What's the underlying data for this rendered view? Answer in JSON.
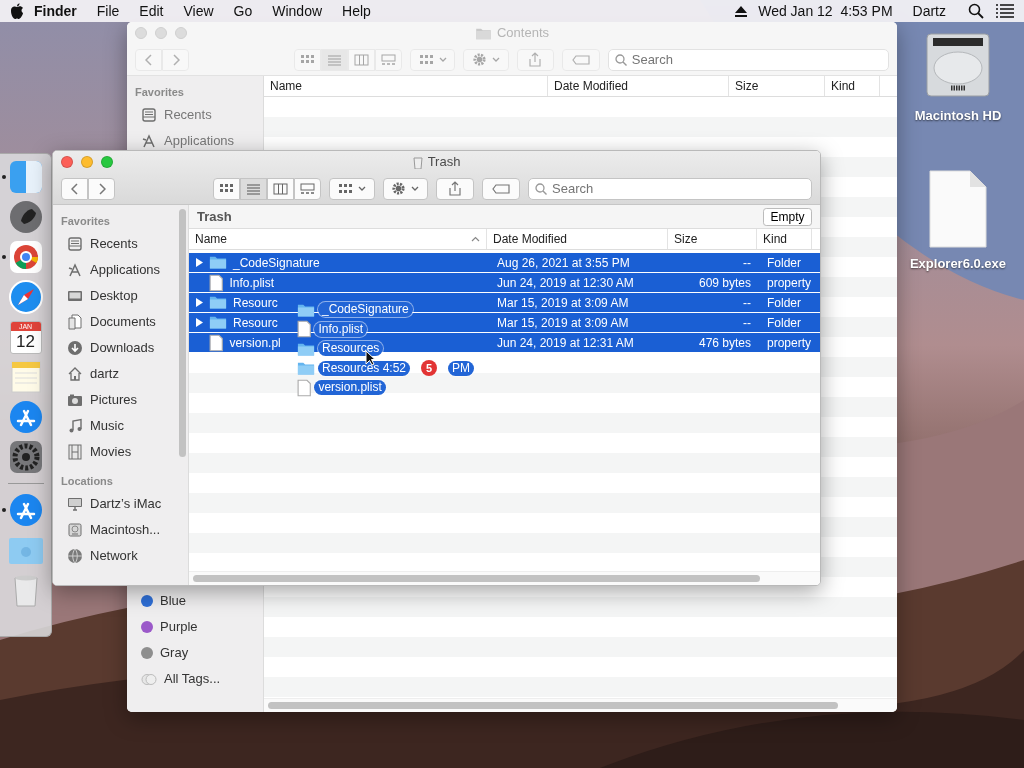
{
  "menu_bar": {
    "app": "Finder",
    "menus": [
      "File",
      "Edit",
      "View",
      "Go",
      "Window",
      "Help"
    ],
    "clock": "Wed Jan 12  4:53 PM",
    "user": "Dartz"
  },
  "back_window": {
    "title": "Contents",
    "search": {
      "placeholder": "Search"
    },
    "favorites_heading": "Favorites",
    "favorites": [
      "Recents",
      "Applications"
    ],
    "tags": [
      {
        "label": "Blue",
        "kind": "color",
        "color": "#2f6fd6"
      },
      {
        "label": "Purple",
        "kind": "color",
        "color": "#9b59c9"
      },
      {
        "label": "Gray",
        "kind": "color",
        "color": "#8e8e8e"
      },
      {
        "label": "All Tags...",
        "kind": "all"
      }
    ],
    "columns": [
      "Name",
      "Date Modified",
      "Size",
      "Kind"
    ]
  },
  "trash_window": {
    "title": "Trash",
    "path": "Trash",
    "empty_button": "Empty",
    "search": {
      "placeholder": "Search"
    },
    "sections": [
      {
        "heading": "Favorites",
        "items": [
          "Recents",
          "Applications",
          "Desktop",
          "Documents",
          "Downloads",
          "dartz",
          "Pictures",
          "Music",
          "Movies"
        ]
      },
      {
        "heading": "Locations",
        "items": [
          "Dartz’s iMac",
          "Macintosh...",
          "Network"
        ]
      }
    ],
    "columns": [
      "Name",
      "Date Modified",
      "Size",
      "Kind"
    ],
    "rows": [
      {
        "name": "_CodeSignature",
        "kind": "folder",
        "expandable": true,
        "selected": true,
        "date": "Aug 26, 2021 at 3:55 PM",
        "size": "--",
        "kind_label": "Folder"
      },
      {
        "name": "Info.plist",
        "kind": "file",
        "expandable": false,
        "selected": true,
        "date": "Jun 24, 2019 at 12:30 AM",
        "size": "609 bytes",
        "kind_label": "property"
      },
      {
        "name": "Resourc",
        "kind": "folder",
        "expandable": true,
        "selected": true,
        "date": "Mar 15, 2019 at 3:09 AM",
        "size": "--",
        "kind_label": "Folder"
      },
      {
        "name": "Resourc",
        "kind": "folder",
        "expandable": true,
        "selected": true,
        "date": "Mar 15, 2019 at 3:09 AM",
        "size": "--",
        "kind_label": "Folder"
      },
      {
        "name": "version.pl",
        "kind": "file",
        "expandable": false,
        "selected": true,
        "date": "Jun 24, 2019 at 12:31 AM",
        "size": "476 bytes",
        "kind_label": "property"
      }
    ]
  },
  "drag": {
    "items": [
      {
        "name": "_CodeSignature",
        "kind": "folder"
      },
      {
        "name": "Info.plist",
        "kind": "file"
      },
      {
        "name": "Resources",
        "kind": "folder"
      },
      {
        "name": "Resources 4:52",
        "suffix": "PM",
        "kind": "folder"
      },
      {
        "name": "version.plist",
        "kind": "file"
      }
    ],
    "count": "5"
  },
  "dock": {
    "items": [
      {
        "running": true
      },
      {
        "running": false
      },
      {
        "running": true
      },
      {
        "running": false
      },
      {
        "running": false,
        "month": "JAN",
        "day": "12"
      },
      {
        "running": false
      },
      {
        "running": false
      },
      {
        "running": false
      },
      {
        "running": true
      },
      {
        "running": false
      },
      {
        "running": false
      }
    ]
  },
  "desktop_icons": [
    {
      "label": "Macintosh HD",
      "kind": "drive"
    },
    {
      "label": "Explorer6.0.exe",
      "kind": "document"
    }
  ]
}
